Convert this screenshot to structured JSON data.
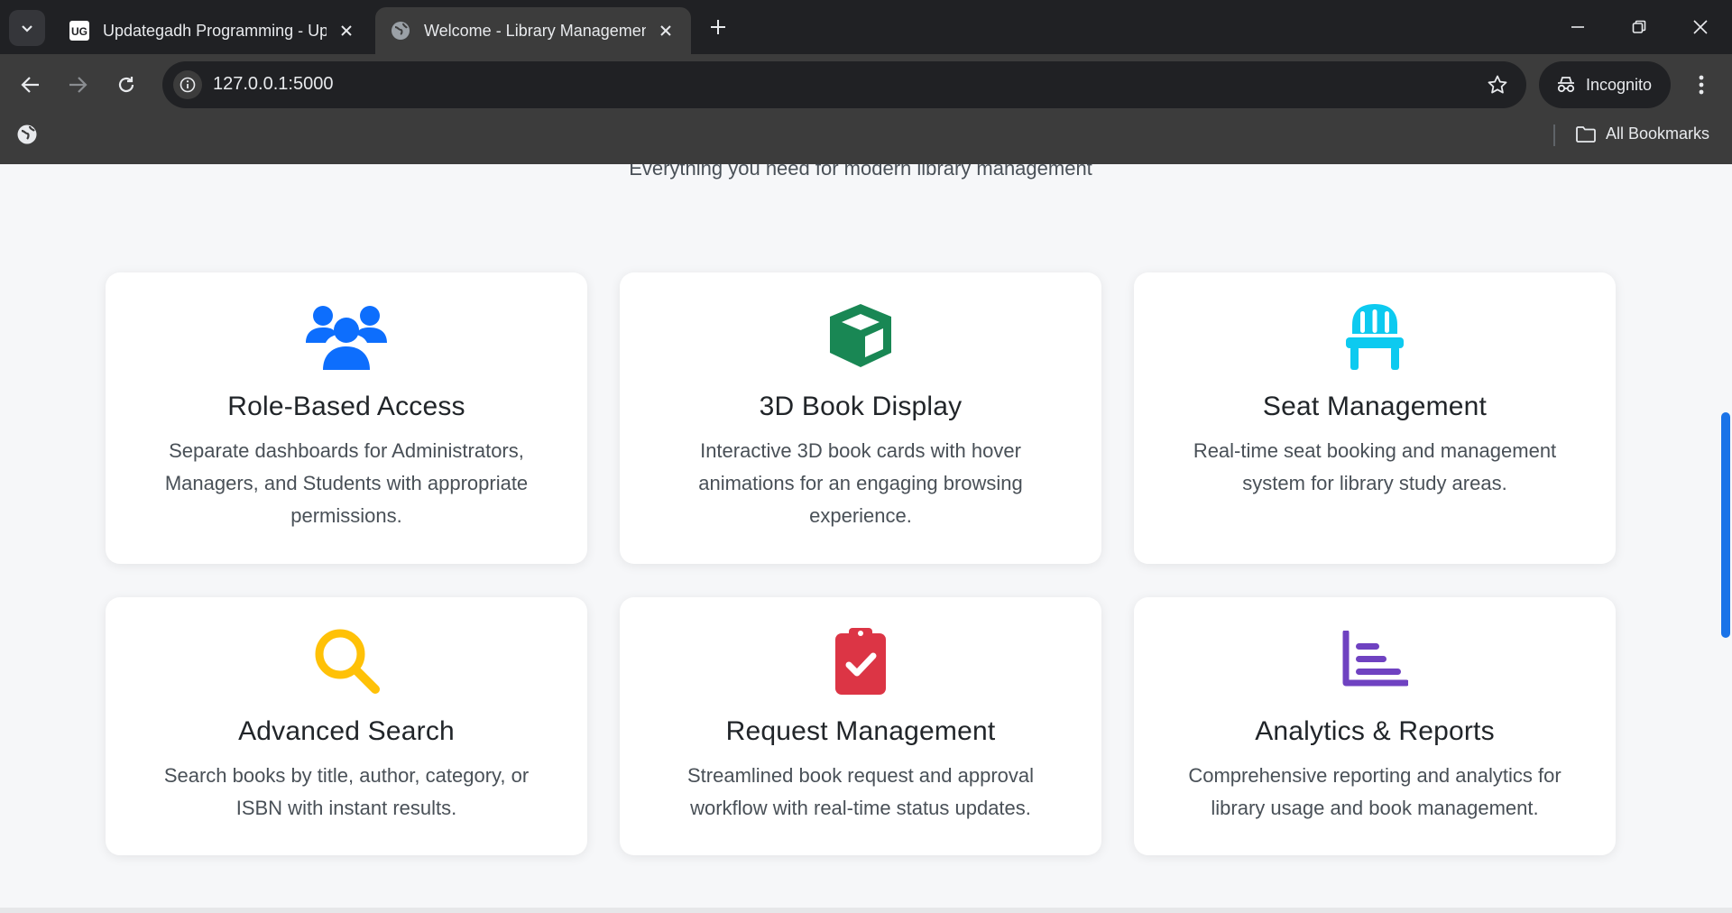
{
  "browser": {
    "tabs": [
      {
        "title": "Updategadh Programming - Up",
        "favicon": "ug-logo-icon",
        "active": false
      },
      {
        "title": "Welcome - Library Managemen",
        "favicon": "globe-icon",
        "active": true
      }
    ],
    "url": "127.0.0.1:5000",
    "profile_label": "Incognito",
    "bookmarks_label": "All Bookmarks"
  },
  "page": {
    "subtitle": "Everything you need for modern library management",
    "features": [
      {
        "icon": "users-icon",
        "color": "#0d6efd",
        "title": "Role-Based Access",
        "description": "Separate dashboards for Administrators, Managers, and Students with appropriate permissions."
      },
      {
        "icon": "box-icon",
        "color": "#198754",
        "title": "3D Book Display",
        "description": "Interactive 3D book cards with hover animations for an engaging browsing experience."
      },
      {
        "icon": "chair-icon",
        "color": "#0dcaf0",
        "title": "Seat Management",
        "description": "Real-time seat booking and management system for library study areas."
      },
      {
        "icon": "search-icon",
        "color": "#ffc107",
        "title": "Advanced Search",
        "description": "Search books by title, author, category, or ISBN with instant results."
      },
      {
        "icon": "clipboard-check-icon",
        "color": "#dc3545",
        "title": "Request Management",
        "description": "Streamlined book request and approval workflow with real-time status updates."
      },
      {
        "icon": "bar-chart-icon",
        "color": "#6f42c1",
        "title": "Analytics & Reports",
        "description": "Comprehensive reporting and analytics for library usage and book management."
      }
    ]
  }
}
